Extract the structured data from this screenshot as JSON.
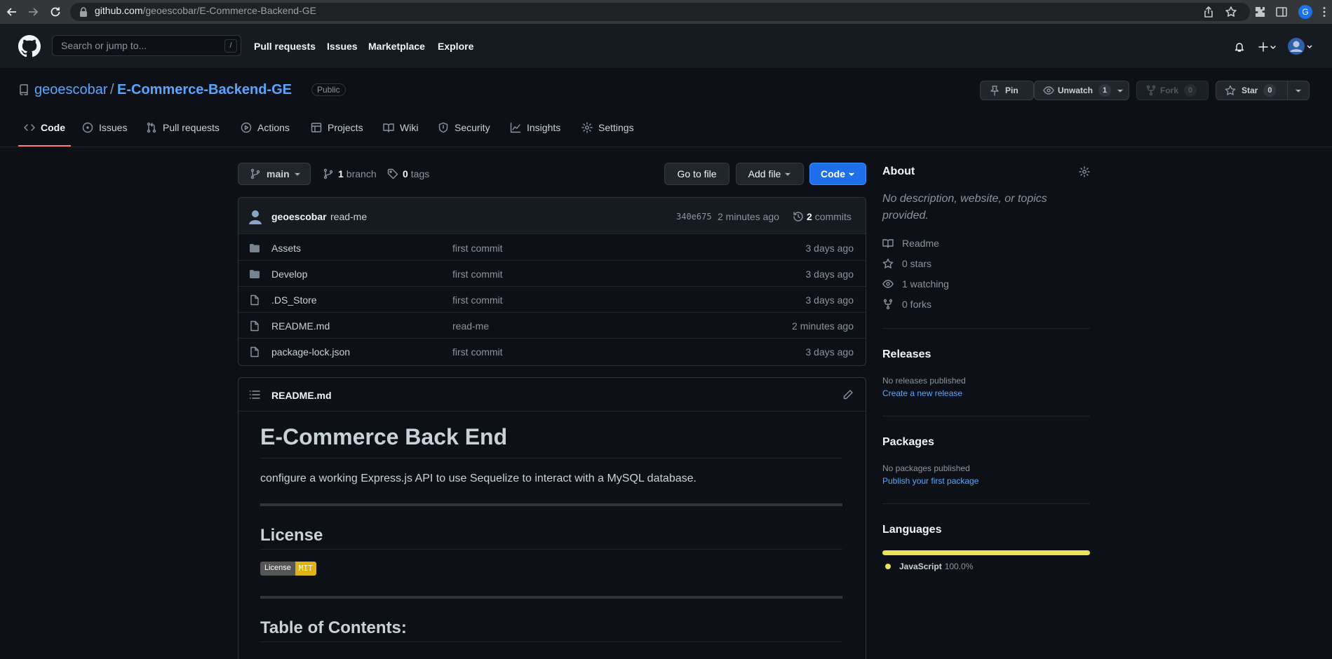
{
  "browser": {
    "url_host": "github.com",
    "url_path": "/geoescobar/E-Commerce-Backend-GE",
    "profile_initial": "G"
  },
  "header": {
    "search_placeholder": "Search or jump to...",
    "search_shortcut": "/",
    "nav": [
      "Pull requests",
      "Issues",
      "Marketplace",
      "Explore"
    ]
  },
  "repo": {
    "owner": "geoescobar",
    "separator": "/",
    "name": "E-Commerce-Backend-GE",
    "visibility": "Public",
    "pin_label": "Pin",
    "unwatch_label": "Unwatch",
    "unwatch_count": "1",
    "fork_label": "Fork",
    "fork_count": "0",
    "star_label": "Star",
    "star_count": "0"
  },
  "tabs": [
    "Code",
    "Issues",
    "Pull requests",
    "Actions",
    "Projects",
    "Wiki",
    "Security",
    "Insights",
    "Settings"
  ],
  "toolbar": {
    "branch": "main",
    "branch_count": "1",
    "branch_word": "branch",
    "tag_count": "0",
    "tag_word": "tags",
    "go_to_file": "Go to file",
    "add_file": "Add file",
    "code": "Code"
  },
  "latest_commit": {
    "author": "geoescobar",
    "message": "read-me",
    "sha": "340e675",
    "age": "2 minutes ago",
    "commit_count": "2",
    "commit_word": "commits"
  },
  "files": [
    {
      "name": "Assets",
      "type": "folder",
      "message": "first commit",
      "age": "3 days ago"
    },
    {
      "name": "Develop",
      "type": "folder",
      "message": "first commit",
      "age": "3 days ago"
    },
    {
      "name": ".DS_Store",
      "type": "file",
      "message": "first commit",
      "age": "3 days ago"
    },
    {
      "name": "README.md",
      "type": "file",
      "message": "read-me",
      "age": "2 minutes ago"
    },
    {
      "name": "package-lock.json",
      "type": "file",
      "message": "first commit",
      "age": "3 days ago"
    }
  ],
  "readme": {
    "filename": "README.md",
    "title": "E-Commerce Back End",
    "description": "configure a working Express.js API to use Sequelize to interact with a MySQL database.",
    "license_heading": "License",
    "badge_left": "License",
    "badge_right": "MIT",
    "toc_heading": "Table of Contents:"
  },
  "sidebar": {
    "about_heading": "About",
    "about_text": "No description, website, or topics provided.",
    "readme": "Readme",
    "stars": "0 stars",
    "watching": "1 watching",
    "forks": "0 forks",
    "releases_heading": "Releases",
    "releases_text": "No releases published",
    "releases_link": "Create a new release",
    "packages_heading": "Packages",
    "packages_text": "No packages published",
    "packages_link": "Publish your first package",
    "languages_heading": "Languages",
    "language_name": "JavaScript",
    "language_pct": "100.0%",
    "language_share": 1.0,
    "language_color": "#f1e05a"
  },
  "colors": {
    "accent": "#58a6ff",
    "primary_button": "#1f6feb",
    "tab_underline": "#f78166"
  }
}
